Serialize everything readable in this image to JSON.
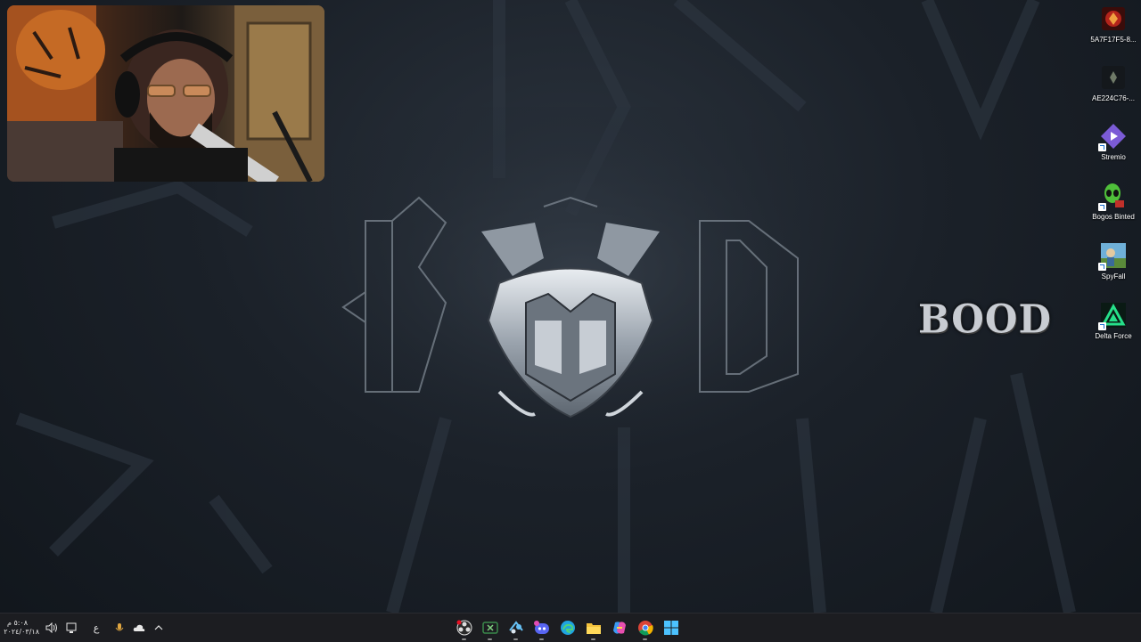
{
  "desktop": {
    "side_text": "BOOD",
    "icons": [
      {
        "label": "5A7F17F5-8...",
        "icon": "game-app-icon"
      },
      {
        "label": "AE224C76-...",
        "icon": "game-app-icon"
      },
      {
        "label": "Stremio",
        "icon": "stremio-icon"
      },
      {
        "label": "Bogos Binted",
        "icon": "alien-icon"
      },
      {
        "label": "SpyFall",
        "icon": "spyfall-icon"
      },
      {
        "label": "Delta Force",
        "icon": "delta-force-icon"
      }
    ]
  },
  "taskbar": {
    "clock_time": "٥:٠٨ م",
    "clock_date": "٢٠٢٤/٠٣/١٨",
    "language": "ع",
    "tray_icons": [
      "speaker-icon",
      "network-icon",
      "language-indicator",
      "microphone-icon",
      "onedrive-icon",
      "chevron-up-icon"
    ],
    "apps": [
      "obs-icon",
      "xbox-icon",
      "steam-icon",
      "discord-icon",
      "edge-icon",
      "file-explorer-icon",
      "copilot-icon",
      "chrome-icon",
      "start-icon"
    ]
  },
  "colors": {
    "taskbar_bg": "#1c1d21",
    "accent": "#0078d4"
  }
}
